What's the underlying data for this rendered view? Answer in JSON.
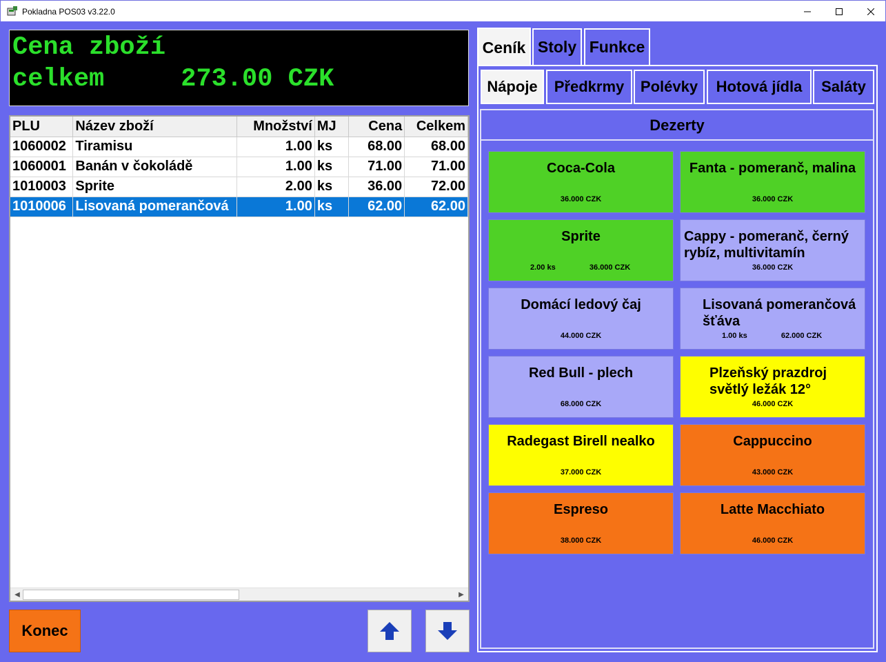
{
  "window": {
    "title": "Pokladna POS03 v3.22.0"
  },
  "display": {
    "line1": "Cena zboží",
    "line2": "celkem     273.00 CZK"
  },
  "table": {
    "headers": [
      "PLU",
      "Název zboží",
      "Množství",
      "MJ",
      "Cena",
      "Celkem"
    ],
    "rows": [
      {
        "plu": "1060002",
        "name": "Tiramisu",
        "qty": "1.00",
        "unit": "ks",
        "price": "68.00",
        "total": "68.00"
      },
      {
        "plu": "1060001",
        "name": "Banán v čokoládě",
        "qty": "1.00",
        "unit": "ks",
        "price": "71.00",
        "total": "71.00"
      },
      {
        "plu": "1010003",
        "name": "Sprite",
        "qty": "2.00",
        "unit": "ks",
        "price": "36.00",
        "total": "72.00"
      },
      {
        "plu": "1010006",
        "name": "Lisovaná pomerančová",
        "qty": "1.00",
        "unit": "ks",
        "price": "62.00",
        "total": "62.00"
      }
    ],
    "selected_row": 3
  },
  "buttons": {
    "konec": "Konec"
  },
  "top_tabs": [
    "Ceník",
    "Stoly",
    "Funkce"
  ],
  "sub_tabs": [
    "Nápoje",
    "Předkrmy",
    "Polévky",
    "Hotová jídla",
    "Saláty"
  ],
  "category_title": "Dezerty",
  "products": [
    {
      "name": "Coca-Cola",
      "price": "36.000 CZK",
      "qty": "",
      "color": "#4fd126"
    },
    {
      "name": "Fanta - pomeranč, malina",
      "price": "36.000 CZK",
      "qty": "",
      "color": "#4fd126"
    },
    {
      "name": "Sprite",
      "price": "36.000 CZK",
      "qty": "2.00 ks",
      "color": "#4fd126"
    },
    {
      "name": "Cappy - pomeranč, černý rybíz, multivitamín",
      "price": "36.000 CZK",
      "qty": "",
      "color": "#a8a8f8"
    },
    {
      "name": "Domácí ledový čaj",
      "price": "44.000 CZK",
      "qty": "",
      "color": "#a8a8f8"
    },
    {
      "name": "Lisovaná pomerančová šťáva",
      "price": "62.000 CZK",
      "qty": "1.00 ks",
      "color": "#a8a8f8"
    },
    {
      "name": "Red Bull - plech",
      "price": "68.000 CZK",
      "qty": "",
      "color": "#a8a8f8"
    },
    {
      "name": "Plzeňský prazdroj světlý ležák 12°",
      "price": "46.000 CZK",
      "qty": "",
      "color": "#fefe00"
    },
    {
      "name": "Radegast Birell nealko",
      "price": "37.000 CZK",
      "qty": "",
      "color": "#fefe00"
    },
    {
      "name": "Cappuccino",
      "price": "43.000 CZK",
      "qty": "",
      "color": "#f57316"
    },
    {
      "name": "Espreso",
      "price": "38.000 CZK",
      "qty": "",
      "color": "#f57316"
    },
    {
      "name": "Latte Macchiato",
      "price": "46.000 CZK",
      "qty": "",
      "color": "#f57316"
    }
  ],
  "icons": {
    "app": "pos-app-icon",
    "up": "arrow-up-icon",
    "down": "arrow-down-icon"
  }
}
